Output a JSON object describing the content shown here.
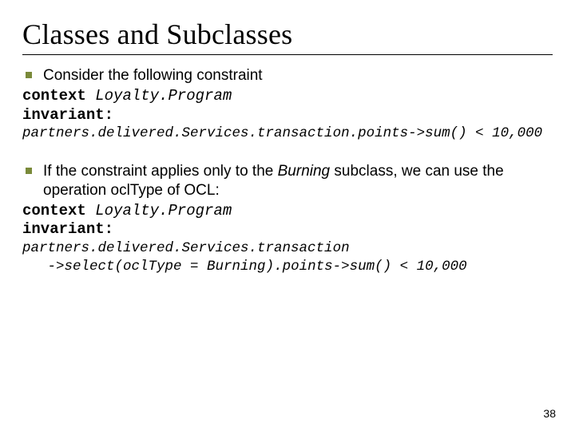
{
  "title": "Classes and Subclasses",
  "block1": {
    "bullet": "Consider the following constraint",
    "ctx_kw": "context",
    "ctx_name": "Loyalty.Program",
    "inv_kw": "invariant:",
    "code": "partners.delivered.Services.transaction.points->sum() < 10,000"
  },
  "block2": {
    "bullet_pre": "If the constraint applies only to the ",
    "bullet_em": "Burning",
    "bullet_mid": " subclass, we can use the operation ",
    "bullet_op": "oclType",
    "bullet_post": " of OCL:",
    "ctx_kw": "context",
    "ctx_name": "Loyalty.Program",
    "inv_kw": "invariant:",
    "code_l1": "partners.delivered.Services.transaction",
    "code_l2a": "   ->select(",
    "code_l2b": "oclType",
    "code_l2c": " = Burning).points->sum() < 10,000"
  },
  "page": "38"
}
